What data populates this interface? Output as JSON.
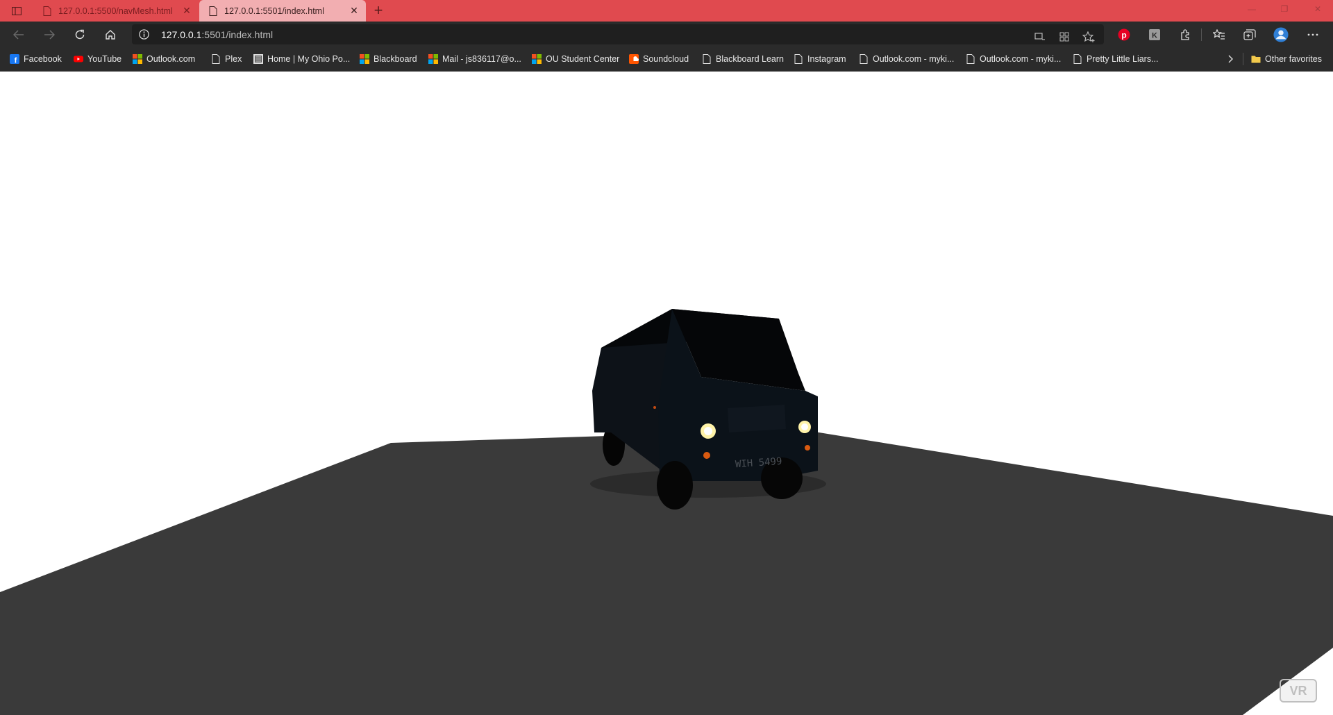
{
  "tabs": [
    {
      "title": "127.0.0.1:5500/navMesh.html",
      "active": false
    },
    {
      "title": "127.0.0.1:5501/index.html",
      "active": true
    }
  ],
  "address_bar": {
    "host": "127.0.0.1",
    "rest": ":5501/index.html"
  },
  "bookmarks": [
    {
      "label": "Facebook",
      "icon": "facebook-icon"
    },
    {
      "label": "YouTube",
      "icon": "youtube-icon"
    },
    {
      "label": "Outlook.com",
      "icon": "microsoft-icon"
    },
    {
      "label": "Plex",
      "icon": "page-icon"
    },
    {
      "label": "Home | My Ohio Po...",
      "icon": "site-icon"
    },
    {
      "label": "Blackboard",
      "icon": "microsoft-icon"
    },
    {
      "label": "Mail - js836117@o...",
      "icon": "microsoft-icon"
    },
    {
      "label": "OU Student Center",
      "icon": "microsoft-icon"
    },
    {
      "label": "Soundcloud",
      "icon": "soundcloud-icon"
    },
    {
      "label": "Blackboard Learn",
      "icon": "page-icon"
    },
    {
      "label": "Instagram",
      "icon": "page-icon"
    },
    {
      "label": "Outlook.com - myki...",
      "icon": "page-icon"
    },
    {
      "label": "Outlook.com - myki...",
      "icon": "page-icon"
    },
    {
      "label": "Pretty Little Liars...",
      "icon": "page-icon"
    }
  ],
  "other_favorites": "Other favorites",
  "scene": {
    "license_plate": "WIH 5499",
    "vr_button": "VR",
    "colors": {
      "ground": "#3a3a3a",
      "sky": "#ffffff",
      "van": "#0c141c",
      "headlight": "#fff3a8"
    }
  },
  "colors": {
    "tabbar": "#e04a4f",
    "active_tab": "#f2aeb1",
    "toolbar": "#2b2b2b"
  }
}
